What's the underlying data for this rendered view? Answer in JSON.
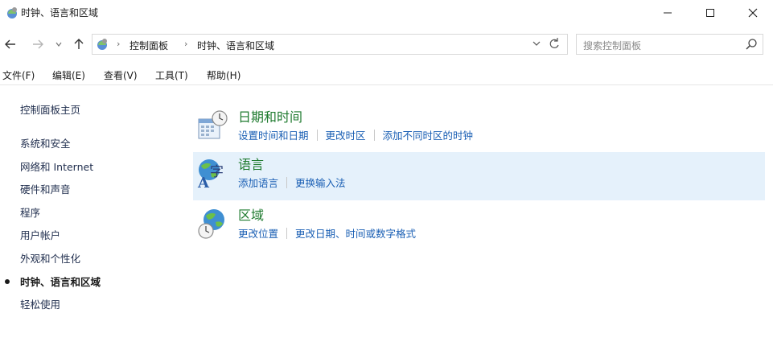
{
  "window": {
    "title": "时钟、语言和区域",
    "minimize_icon": "minimize-icon",
    "maximize_icon": "maximize-icon",
    "close_icon": "close-icon"
  },
  "nav": {
    "back_icon": "arrow-left-icon",
    "forward_icon": "arrow-right-icon",
    "recent_icon": "chevron-down-icon",
    "up_icon": "arrow-up-icon"
  },
  "address": {
    "segments": [
      "控制面板",
      "时钟、语言和区域"
    ],
    "separator": "›",
    "dropdown_icon": "chevron-down-icon",
    "refresh_icon": "refresh-icon"
  },
  "search": {
    "placeholder": "搜索控制面板"
  },
  "menu": [
    "文件(F)",
    "编辑(E)",
    "查看(V)",
    "工具(T)",
    "帮助(H)"
  ],
  "sidebar": {
    "items": [
      {
        "label": "控制面板主页",
        "current": false
      },
      {
        "label": "系统和安全",
        "current": false
      },
      {
        "label": "网络和 Internet",
        "current": false
      },
      {
        "label": "硬件和声音",
        "current": false
      },
      {
        "label": "程序",
        "current": false
      },
      {
        "label": "用户帐户",
        "current": false
      },
      {
        "label": "外观和个性化",
        "current": false
      },
      {
        "label": "时钟、语言和区域",
        "current": true
      },
      {
        "label": "轻松使用",
        "current": false
      }
    ]
  },
  "categories": [
    {
      "title": "日期和时间",
      "icon": "calendar-clock-icon",
      "links": [
        "设置时间和日期",
        "更改时区",
        "添加不同时区的时钟"
      ]
    },
    {
      "title": "语言",
      "icon": "language-globe-icon",
      "links": [
        "添加语言",
        "更换输入法"
      ],
      "highlighted": true
    },
    {
      "title": "区域",
      "icon": "region-globe-clock-icon",
      "links": [
        "更改位置",
        "更改日期、时间或数字格式"
      ]
    }
  ],
  "colors": {
    "category_title": "#1e7a2e",
    "link": "#1a5fb4",
    "highlight_bg": "#e5f1fb"
  }
}
